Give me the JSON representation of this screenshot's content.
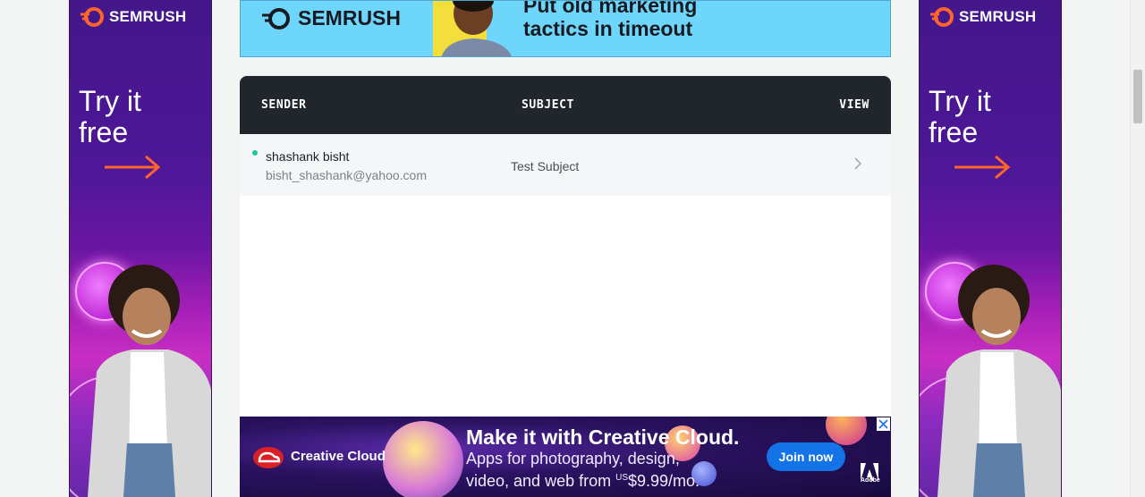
{
  "left_ad": {
    "brand": "SEMRUSH",
    "tagline_line1": "Try it",
    "tagline_line2": "free"
  },
  "right_ad": {
    "brand": "SEMRUSH",
    "tagline_line1": "Try it",
    "tagline_line2": "free"
  },
  "top_banner": {
    "brand": "SEMRUSH",
    "headline_line1": "Put old marketing",
    "headline_line2": "tactics in timeout"
  },
  "inbox": {
    "columns": {
      "sender": "SENDER",
      "subject": "SUBJECT",
      "view": "VIEW"
    },
    "messages": [
      {
        "sender_name": "shashank bisht",
        "sender_email": "bisht_shashank@yahoo.com",
        "subject": "Test Subject",
        "unread": true
      }
    ]
  },
  "bottom_banner": {
    "product": "Creative Cloud",
    "title": "Make it with Creative Cloud.",
    "sub_line1": "Apps for photography, design,",
    "sub_line2_prefix": "video, and web from ",
    "currency": "US",
    "price": "$9.99/mo.",
    "cta": "Join now",
    "vendor": "Adobe"
  },
  "colors": {
    "semrush_orange": "#ff642d",
    "header_dark": "#21252c",
    "unread_dot": "#20c2a0",
    "adobe_blue": "#1473e6",
    "top_banner_bg": "#6fd6fb"
  }
}
